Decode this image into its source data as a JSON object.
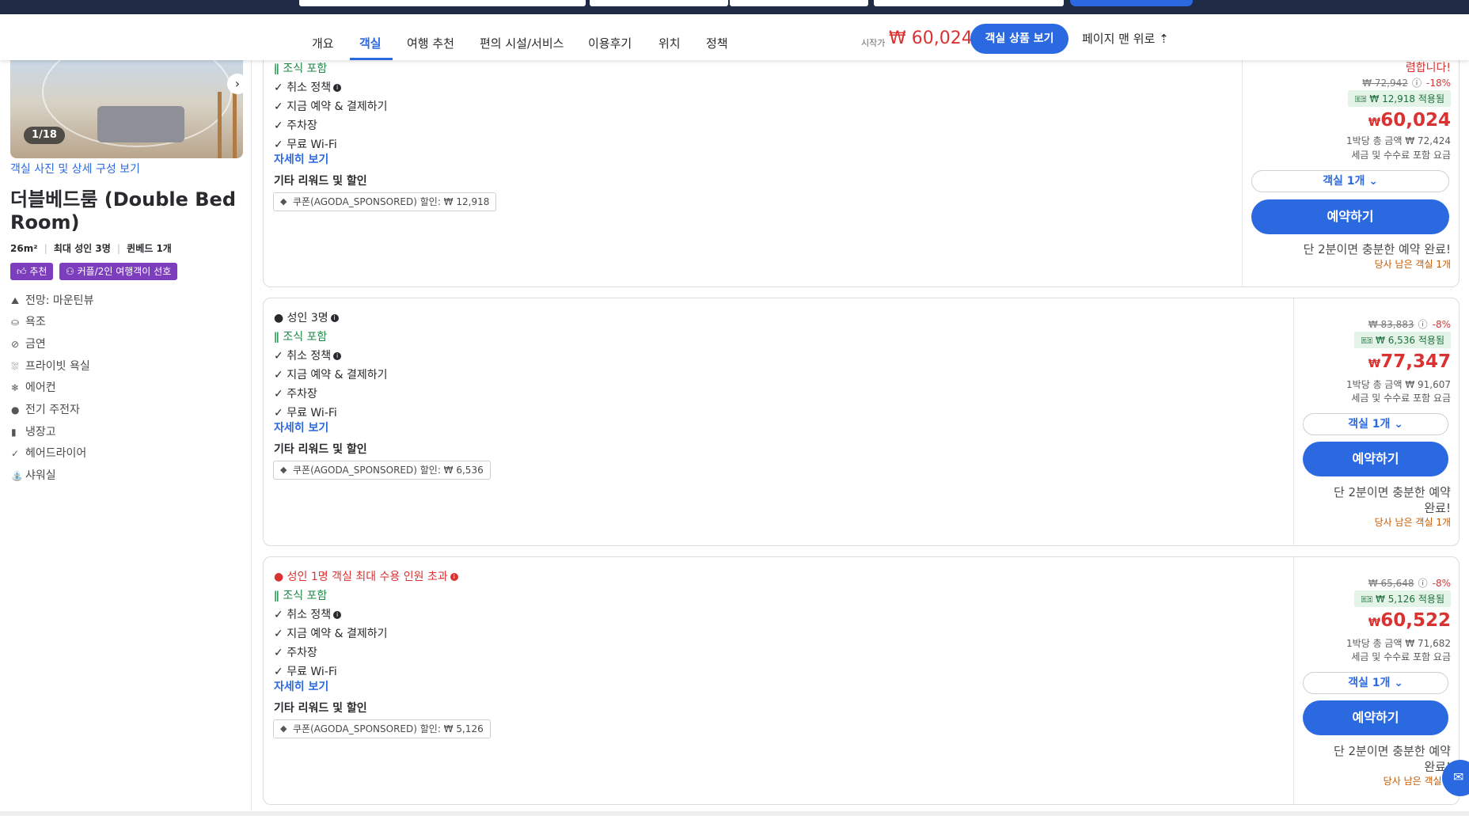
{
  "nav": {
    "tabs": [
      "개요",
      "객실",
      "여행 추천",
      "편의 시설/서비스",
      "이용후기",
      "위치",
      "정책"
    ],
    "active_tab": "객실",
    "price_from_label": "시작가",
    "price_from": "₩ 60,024",
    "view_button": "객실 상품 보기",
    "top_link": "페이지 맨 위로"
  },
  "room": {
    "photo_counter": "1/18",
    "photo_link": "객실 사진 및 상세 구성 보기",
    "title": "더블베드룸 (Double Bed Room)",
    "meta": [
      "26m²",
      "최대 성인 3명",
      "퀸베드 1개"
    ],
    "badges": [
      "추천",
      "커플/2인 여행객이 선호"
    ],
    "amenities": [
      {
        "icon": "view-icon",
        "label": "전망: 마운틴뷰"
      },
      {
        "icon": "bathtub-icon",
        "label": "욕조"
      },
      {
        "icon": "no-smoking-icon",
        "label": "금연"
      },
      {
        "icon": "shower-icon",
        "label": "프라이빗 욕실"
      },
      {
        "icon": "aircon-icon",
        "label": "에어컨"
      },
      {
        "icon": "kettle-icon",
        "label": "전기 주전자"
      },
      {
        "icon": "fridge-icon",
        "label": "냉장고"
      },
      {
        "icon": "check-icon",
        "label": "헤어드라이어"
      },
      {
        "icon": "shower-head-icon",
        "label": "샤워실"
      }
    ]
  },
  "offers": [
    {
      "occupancy": "",
      "breakfast": "조식 포함",
      "features": [
        "취소 정책",
        "지금 예약 & 결제하기",
        "주차장",
        "무료 Wi-Fi"
      ],
      "details_link": "자세히 보기",
      "other_heading": "기타 리워드 및 할인",
      "coupon": "쿠폰(AGODA_SPONSORED) 할인: ₩ 12,918",
      "top_note": "렴합니다!",
      "original": "₩ 72,942",
      "discount": "-18%",
      "applied": "₩ 12,918 적용됨",
      "price": "60,024",
      "currency": "₩",
      "total": "1박당 총 금액 ₩ 72,424",
      "tax_note": "세금 및 수수료 포함 요금",
      "room_select": "객실 1개",
      "book": "예약하기",
      "quick_note": "단 2분이면 충분한 예약 완료!",
      "left_note": "당사 남은 객실 1개"
    },
    {
      "occupancy": "성인 3명",
      "breakfast": "조식 포함",
      "features": [
        "취소 정책",
        "지금 예약 & 결제하기",
        "주차장",
        "무료 Wi-Fi"
      ],
      "details_link": "자세히 보기",
      "other_heading": "기타 리워드 및 할인",
      "coupon": "쿠폰(AGODA_SPONSORED) 할인: ₩ 6,536",
      "original": "₩ 83,883",
      "discount": "-8%",
      "applied": "₩ 6,536 적용됨",
      "price": "77,347",
      "currency": "₩",
      "total": "1박당 총 금액 ₩ 91,607",
      "tax_note": "세금 및 수수료 포함 요금",
      "room_select": "객실 1개",
      "book": "예약하기",
      "quick_note_1": "단 2분이면 충분한 예약",
      "quick_note_2": "완료!",
      "left_note": "당사 남은 객실 1개"
    },
    {
      "occupancy": "성인 1명 객실 최대 수용 인원 초과",
      "breakfast": "조식 포함",
      "features": [
        "취소 정책",
        "지금 예약 & 결제하기",
        "주차장",
        "무료 Wi-Fi"
      ],
      "details_link": "자세히 보기",
      "other_heading": "기타 리워드 및 할인",
      "coupon": "쿠폰(AGODA_SPONSORED) 할인: ₩ 5,126",
      "original": "₩ 65,648",
      "discount": "-8%",
      "applied": "₩ 5,126 적용됨",
      "price": "60,522",
      "currency": "₩",
      "total": "1박당 총 금액 ₩ 71,682",
      "tax_note": "세금 및 수수료 포함 요금",
      "room_select": "객실 1개",
      "book": "예약하기",
      "quick_note_1": "단 2분이면 충분한 예약",
      "quick_note_2": "완료!",
      "left_note": "당사 남은 객실 1"
    }
  ]
}
